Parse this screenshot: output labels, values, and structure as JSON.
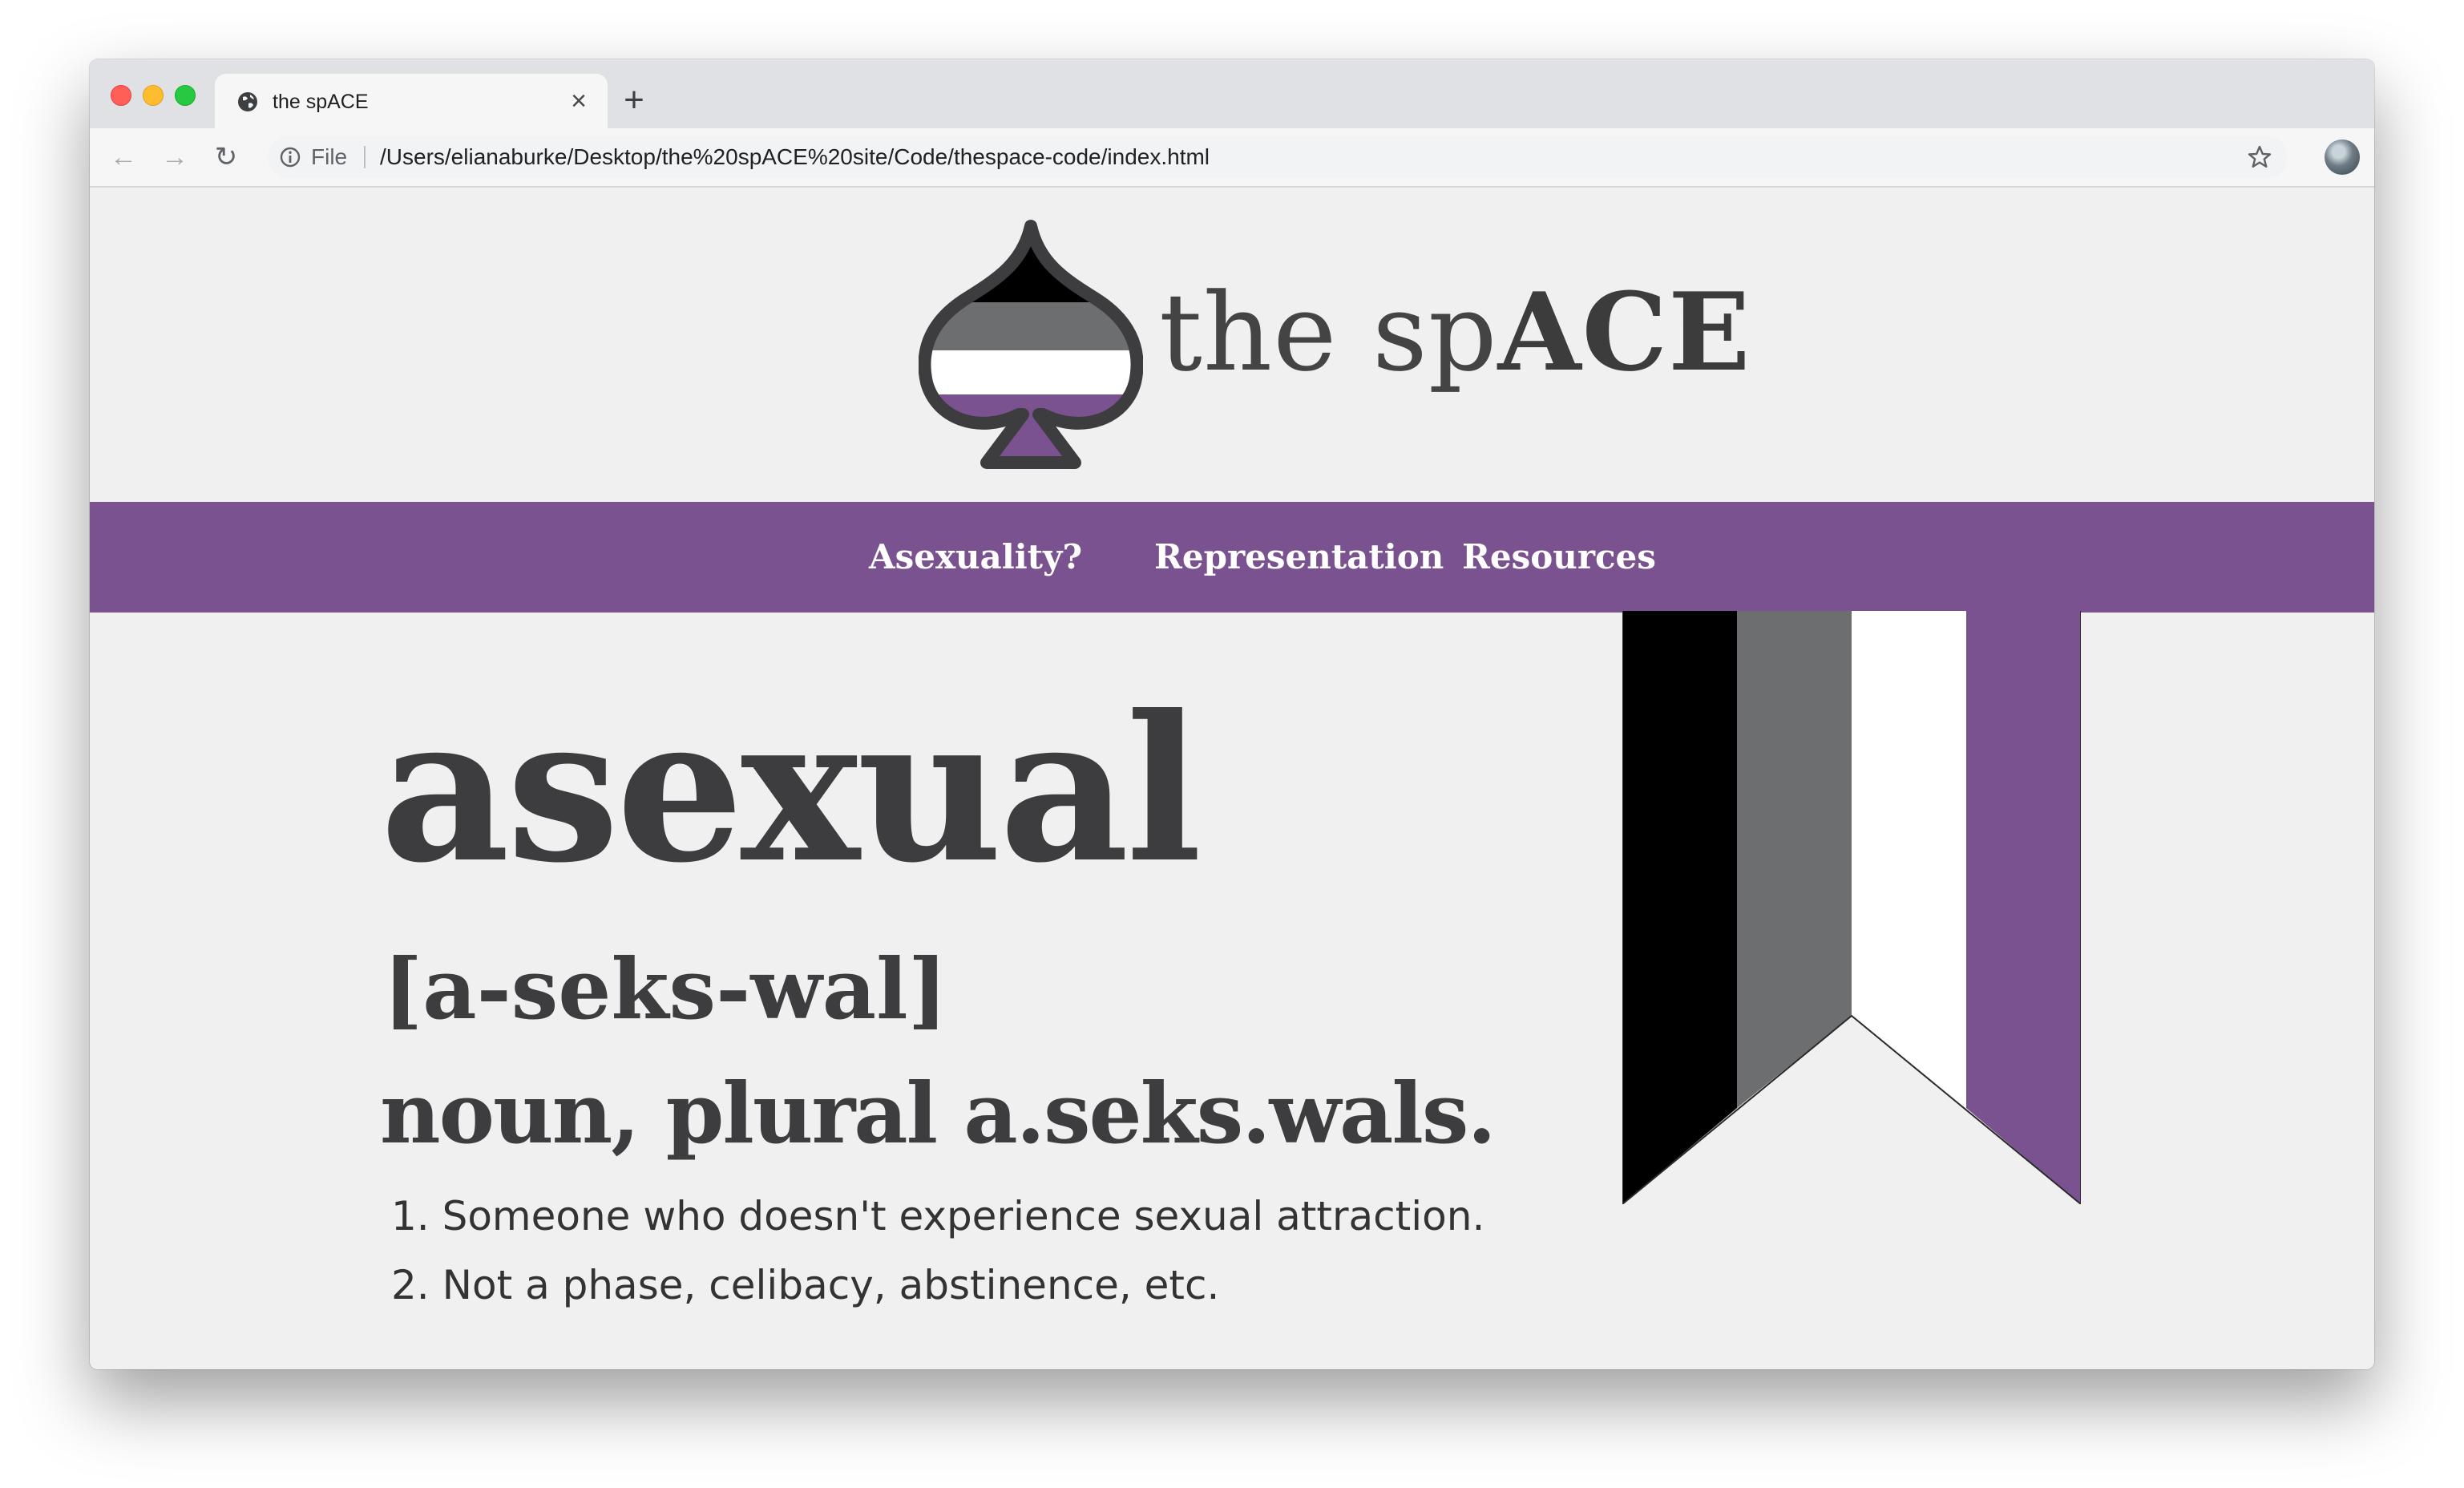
{
  "browser": {
    "tab_title": "the spACE",
    "tab_close": "×",
    "new_tab": "+",
    "address_prefix": "File",
    "url": "/Users/elianaburke/Desktop/the%20spACE%20site/Code/thespace-code/index.html",
    "nav": {
      "back": "←",
      "forward": "→",
      "reload": "↻"
    },
    "icons": {
      "tab_favicon": "globe-icon",
      "info": "info-icon",
      "bookmark": "star-icon",
      "profile": "avatar",
      "extension": "update-arrow-icon"
    }
  },
  "site": {
    "title_light": "the sp",
    "title_bold": "ACE",
    "logo": "ace-spade-flag-logo"
  },
  "nav": {
    "items": [
      {
        "label": "Asexuality?"
      },
      {
        "label": "Representation"
      },
      {
        "label": "Resources"
      }
    ]
  },
  "definition": {
    "word": "asexual",
    "pronunciation": "[a-seks-wal]",
    "part_of_speech": "noun, plural a.seks.wals.",
    "senses": [
      "1. Someone who doesn't experience sexual attraction.",
      "2. Not a phase, celibacy, abstinence, etc."
    ]
  },
  "colors": {
    "purple": "#7a528f",
    "black": "#000000",
    "gray": "#6d6e70",
    "white": "#ffffff",
    "text": "#3d3d3f",
    "page_bg": "#f0f0f0"
  }
}
